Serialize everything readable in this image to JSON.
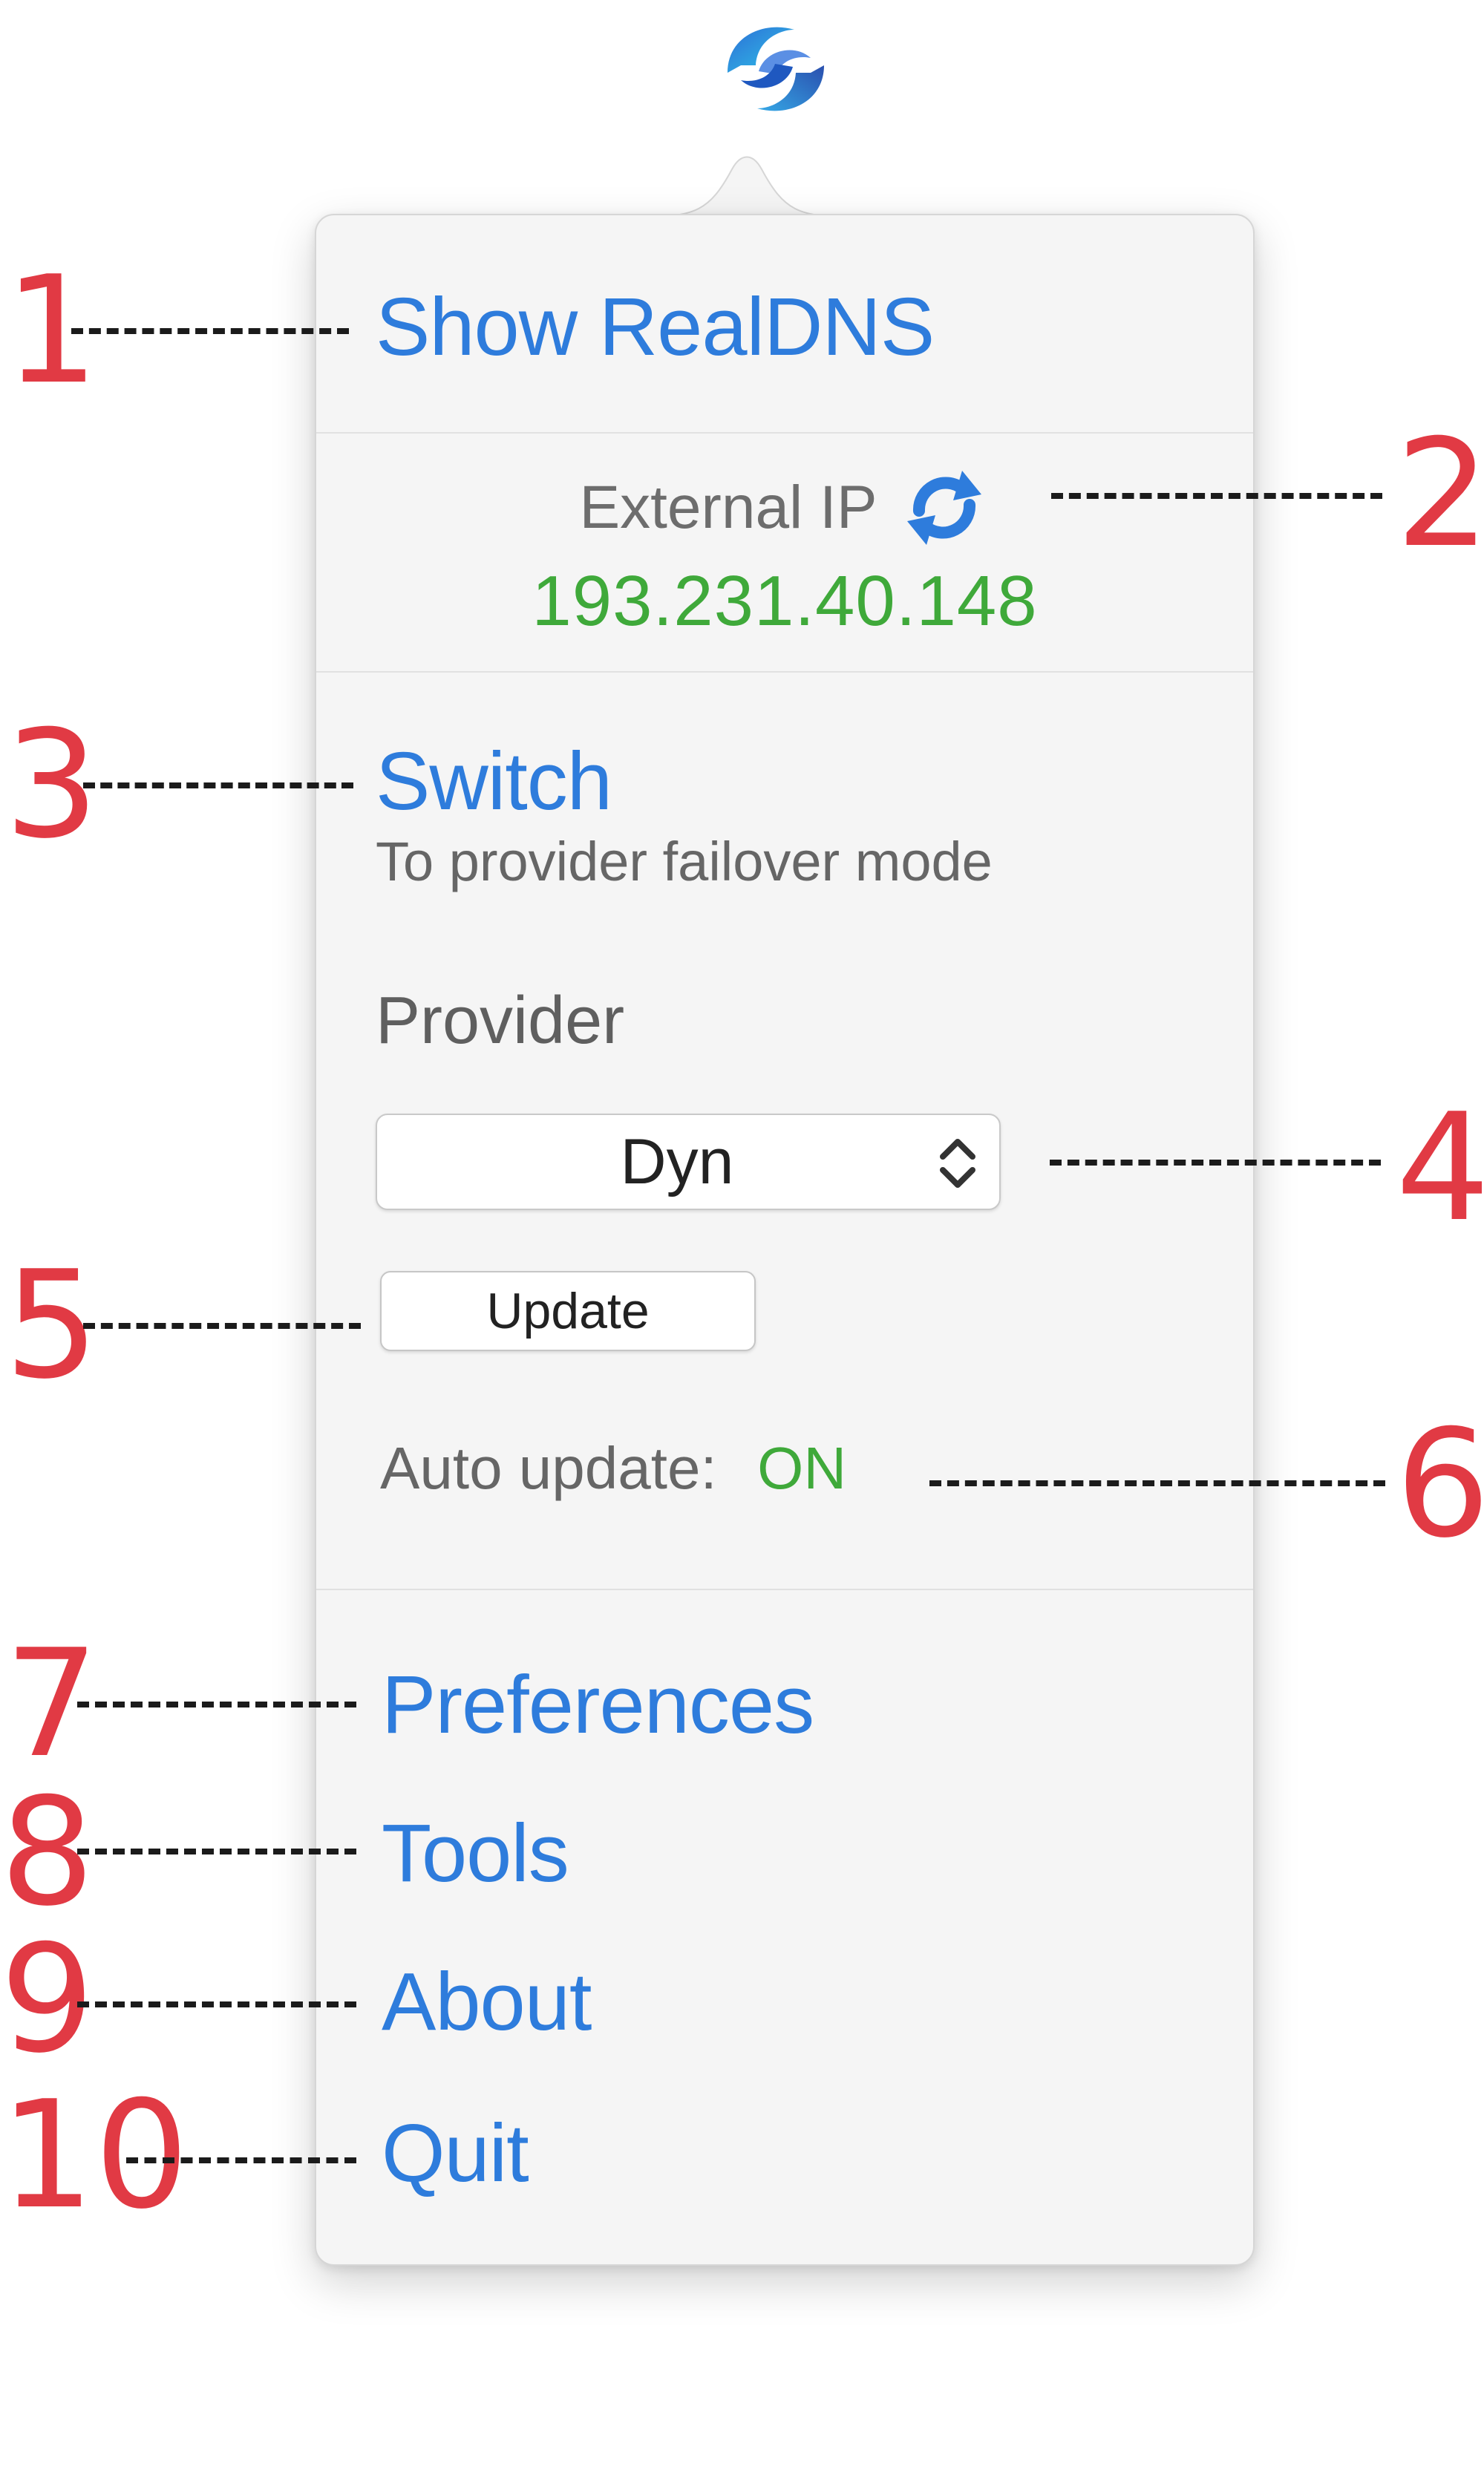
{
  "menu": {
    "show_app": "Show RealDNS",
    "external_ip_label": "External IP",
    "external_ip_value": "193.231.40.148",
    "switch_title": "Switch",
    "switch_subtitle": "To provider failover mode",
    "provider_label": "Provider",
    "provider_selected": "Dyn",
    "update_label": "Update",
    "auto_update_label": "Auto update:",
    "auto_update_value": "ON",
    "items": [
      "Preferences",
      "Tools",
      "About",
      "Quit"
    ]
  },
  "callouts": [
    "1",
    "2",
    "3",
    "4",
    "5",
    "6",
    "7",
    "8",
    "9",
    "10"
  ],
  "colors": {
    "link": "#2e7cdc",
    "status_green": "#3fa93a",
    "callout_red": "#e13a44",
    "panel_background": "#f5f5f5"
  },
  "icons": {
    "app_logo": "realdns-logo-icon",
    "refresh": "refresh-icon",
    "select_arrows": "chevron-up-down-icon"
  }
}
